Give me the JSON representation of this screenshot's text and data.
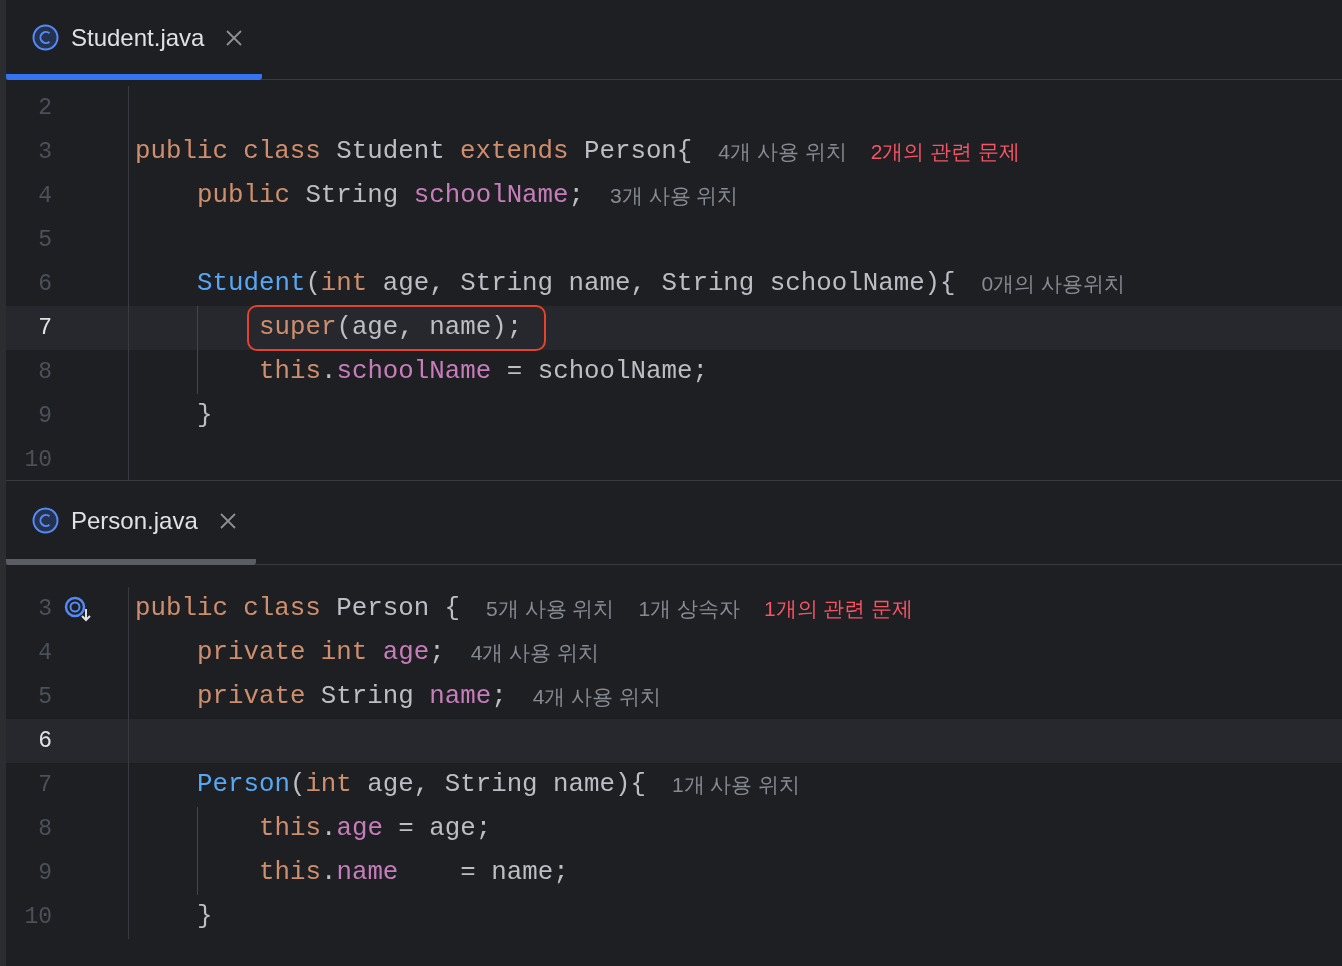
{
  "panes": [
    {
      "tab": {
        "file": "Student.java",
        "selected": true
      },
      "focused": true,
      "lines": [
        {
          "n": "2"
        },
        {
          "n": "3",
          "code": [
            {
              "kind": "kw",
              "t": "public class "
            },
            {
              "kind": "plain",
              "t": "Student "
            },
            {
              "kind": "kw",
              "t": "extends "
            },
            {
              "kind": "plain",
              "t": "Person{"
            }
          ],
          "hints": [
            {
              "kind": "usage",
              "t": "4개 사용 위치"
            },
            {
              "kind": "problem",
              "t": "2개의 관련 문제"
            }
          ],
          "children": [
            {
              "n": "4",
              "code": [
                {
                  "kind": "kw",
                  "t": "public "
                },
                {
                  "kind": "plain",
                  "t": "String "
                },
                {
                  "kind": "field",
                  "t": "schoolName"
                },
                {
                  "kind": "plain",
                  "t": ";"
                }
              ],
              "hints": [
                {
                  "kind": "usage",
                  "t": "3개 사용 위치"
                }
              ]
            },
            {
              "n": "5"
            },
            {
              "n": "6",
              "code": [
                {
                  "kind": "decl",
                  "t": "Student"
                },
                {
                  "kind": "plain",
                  "t": "("
                },
                {
                  "kind": "kw",
                  "t": "int "
                },
                {
                  "kind": "plain",
                  "t": "age, String name, String schoolName){"
                }
              ],
              "hints": [
                {
                  "kind": "usage",
                  "t": "0개의 사용위치"
                }
              ],
              "children": [
                {
                  "n": "7",
                  "current": true,
                  "boxed": true,
                  "code": [
                    {
                      "kind": "kw",
                      "t": "super"
                    },
                    {
                      "kind": "plain",
                      "t": "(age, name);"
                    }
                  ]
                },
                {
                  "n": "8",
                  "code": [
                    {
                      "kind": "kw",
                      "t": "this"
                    },
                    {
                      "kind": "plain",
                      "t": "."
                    },
                    {
                      "kind": "field",
                      "t": "schoolName"
                    },
                    {
                      "kind": "plain",
                      "t": " = schoolName;"
                    }
                  ]
                }
              ]
            },
            {
              "n": "9",
              "code": [
                {
                  "kind": "plain",
                  "t": "}"
                }
              ]
            }
          ]
        },
        {
          "n": "10"
        }
      ]
    },
    {
      "tab": {
        "file": "Person.java",
        "selected": true
      },
      "focused": false,
      "lines": [
        {
          "n": "3",
          "has_subclasses": true,
          "code": [
            {
              "kind": "kw",
              "t": "public class "
            },
            {
              "kind": "plain",
              "t": "Person {"
            }
          ],
          "hints": [
            {
              "kind": "usage",
              "t": "5개 사용 위치"
            },
            {
              "kind": "usage",
              "t": "1개 상속자"
            },
            {
              "kind": "problem",
              "t": "1개의 관련 문제"
            }
          ],
          "children": [
            {
              "n": "4",
              "code": [
                {
                  "kind": "kw",
                  "t": "private int "
                },
                {
                  "kind": "field",
                  "t": "age"
                },
                {
                  "kind": "plain",
                  "t": ";"
                }
              ],
              "hints": [
                {
                  "kind": "usage",
                  "t": "4개 사용 위치"
                }
              ]
            },
            {
              "n": "5",
              "code": [
                {
                  "kind": "kw",
                  "t": "private "
                },
                {
                  "kind": "plain",
                  "t": "String "
                },
                {
                  "kind": "field",
                  "t": "name"
                },
                {
                  "kind": "plain",
                  "t": ";"
                }
              ],
              "hints": [
                {
                  "kind": "usage",
                  "t": "4개 사용 위치"
                }
              ]
            },
            {
              "n": "6",
              "current": true
            },
            {
              "n": "7",
              "code": [
                {
                  "kind": "decl",
                  "t": "Person"
                },
                {
                  "kind": "plain",
                  "t": "("
                },
                {
                  "kind": "kw",
                  "t": "int "
                },
                {
                  "kind": "plain",
                  "t": "age, String name){"
                }
              ],
              "hints": [
                {
                  "kind": "usage",
                  "t": "1개 사용 위치"
                }
              ],
              "children": [
                {
                  "n": "8",
                  "code": [
                    {
                      "kind": "kw",
                      "t": "this"
                    },
                    {
                      "kind": "plain",
                      "t": "."
                    },
                    {
                      "kind": "field",
                      "t": "age"
                    },
                    {
                      "kind": "plain",
                      "t": " = age;"
                    }
                  ]
                },
                {
                  "n": "9",
                  "code": [
                    {
                      "kind": "kw",
                      "t": "this"
                    },
                    {
                      "kind": "plain",
                      "t": "."
                    },
                    {
                      "kind": "field",
                      "t": "name"
                    },
                    {
                      "kind": "plain",
                      "t": "    = name;"
                    }
                  ]
                }
              ]
            },
            {
              "n": "10",
              "code": [
                {
                  "kind": "plain",
                  "t": "}"
                }
              ]
            }
          ]
        }
      ]
    }
  ]
}
